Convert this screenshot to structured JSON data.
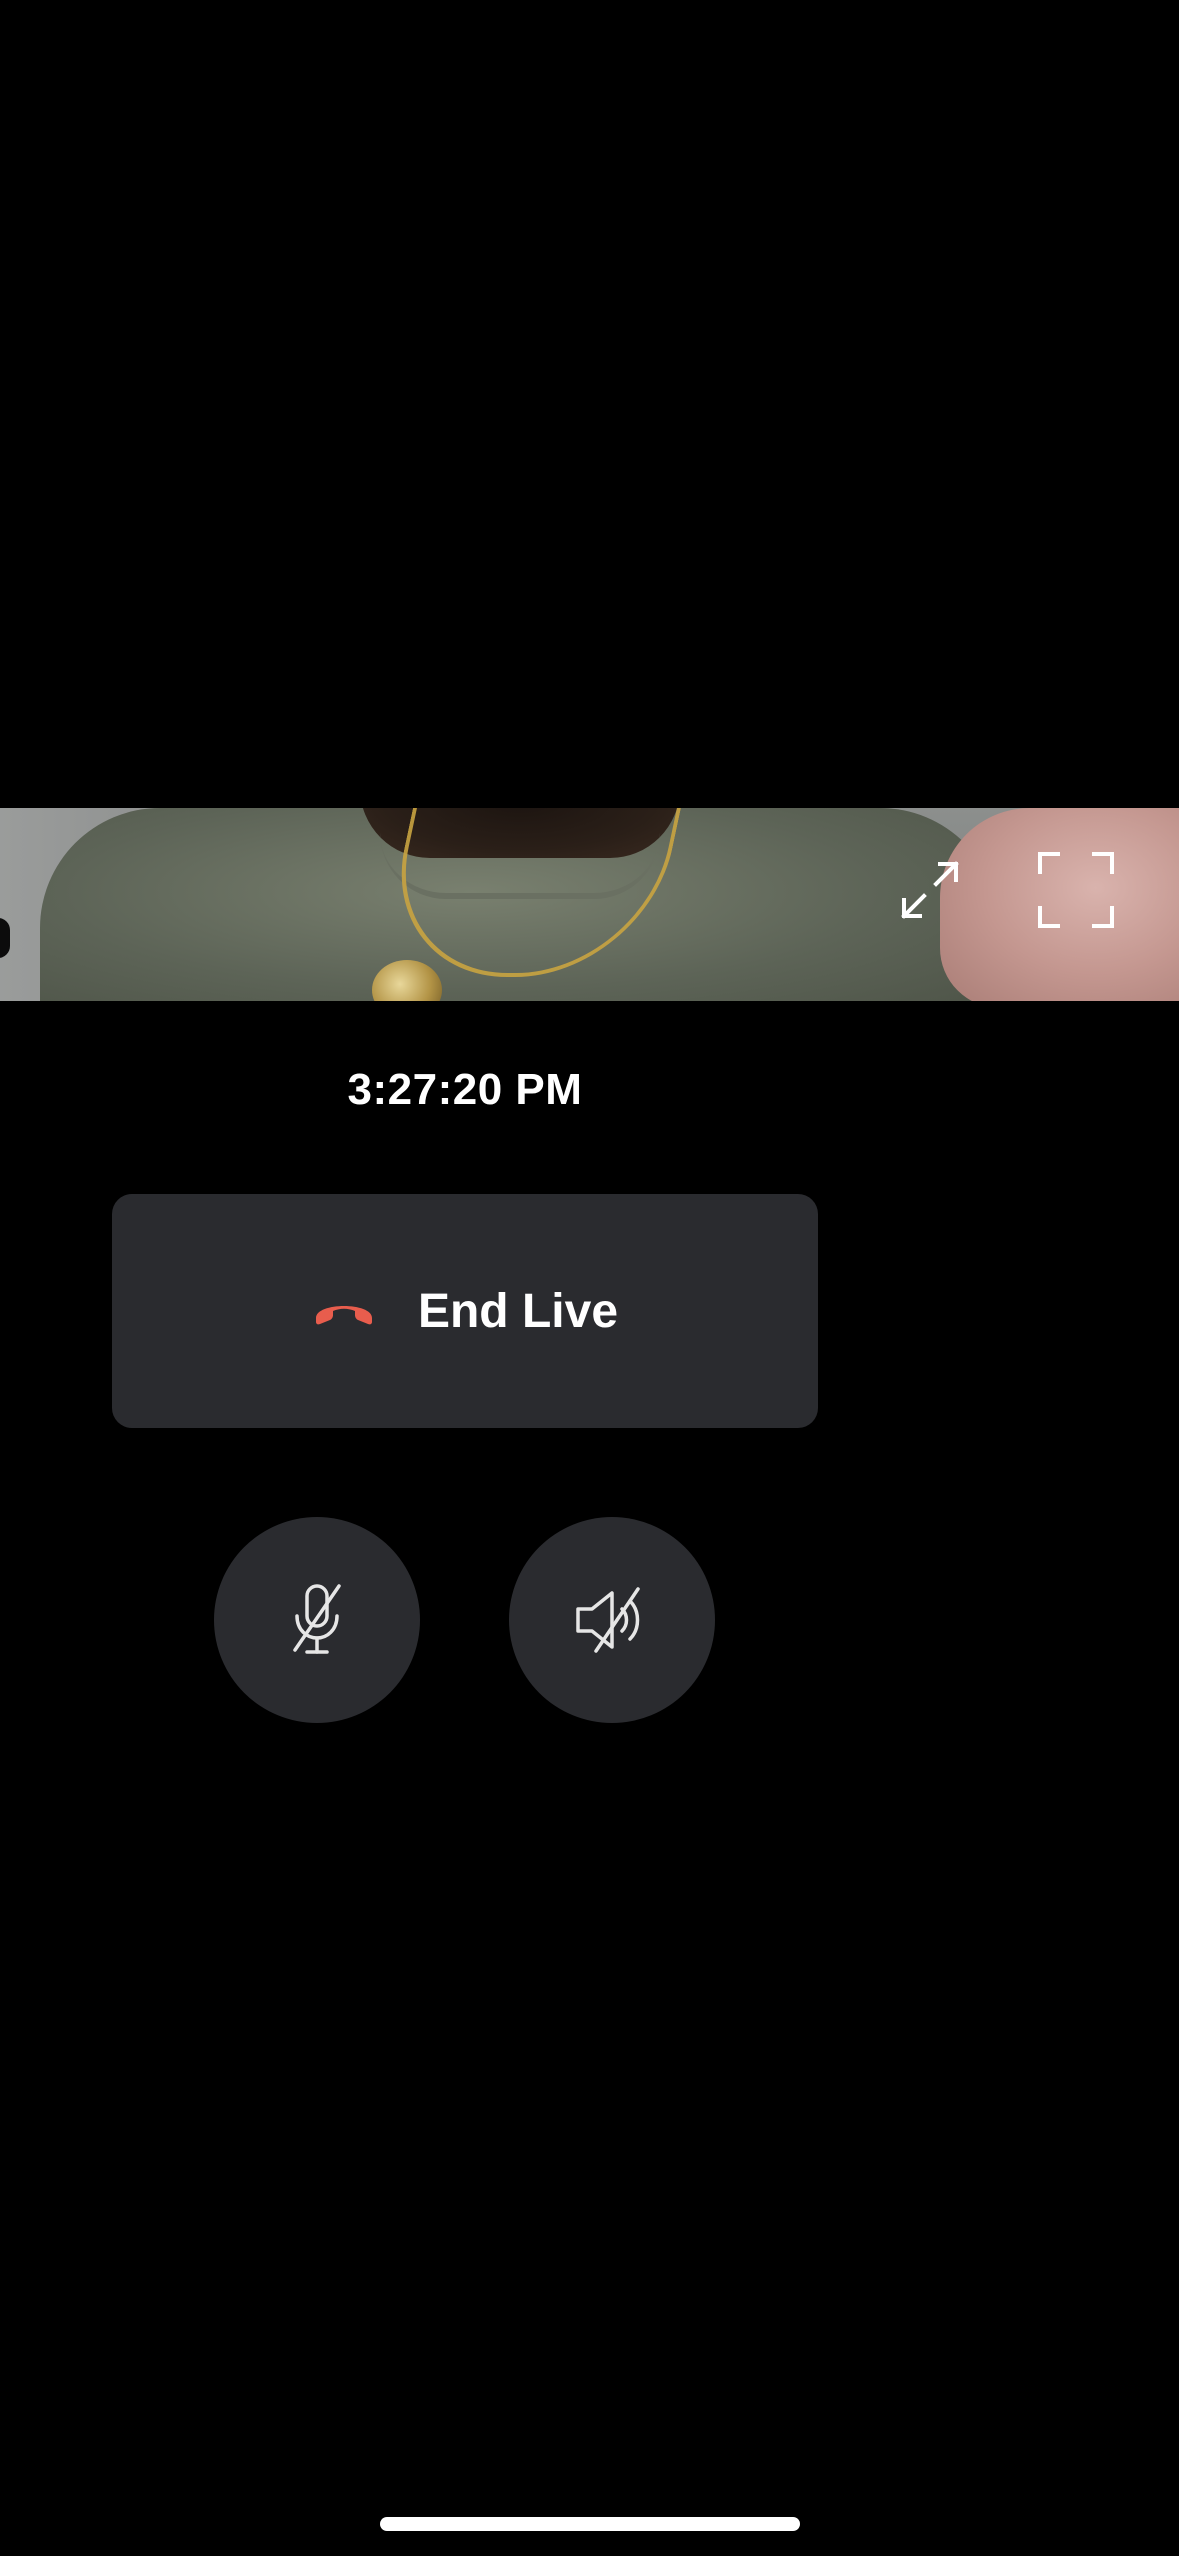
{
  "video": {
    "controls": {
      "expand_icon": "expand-arrows-icon",
      "fullscreen_icon": "fullscreen-corners-icon"
    }
  },
  "session": {
    "timestamp": "3:27:20 PM"
  },
  "end_live": {
    "label": "End Live",
    "icon": "hang-up-phone-icon",
    "icon_color": "#e85d4d",
    "background": "#2a2b2f"
  },
  "audio_controls": {
    "mic_icon": "microphone-muted-icon",
    "speaker_icon": "speaker-muted-icon"
  }
}
